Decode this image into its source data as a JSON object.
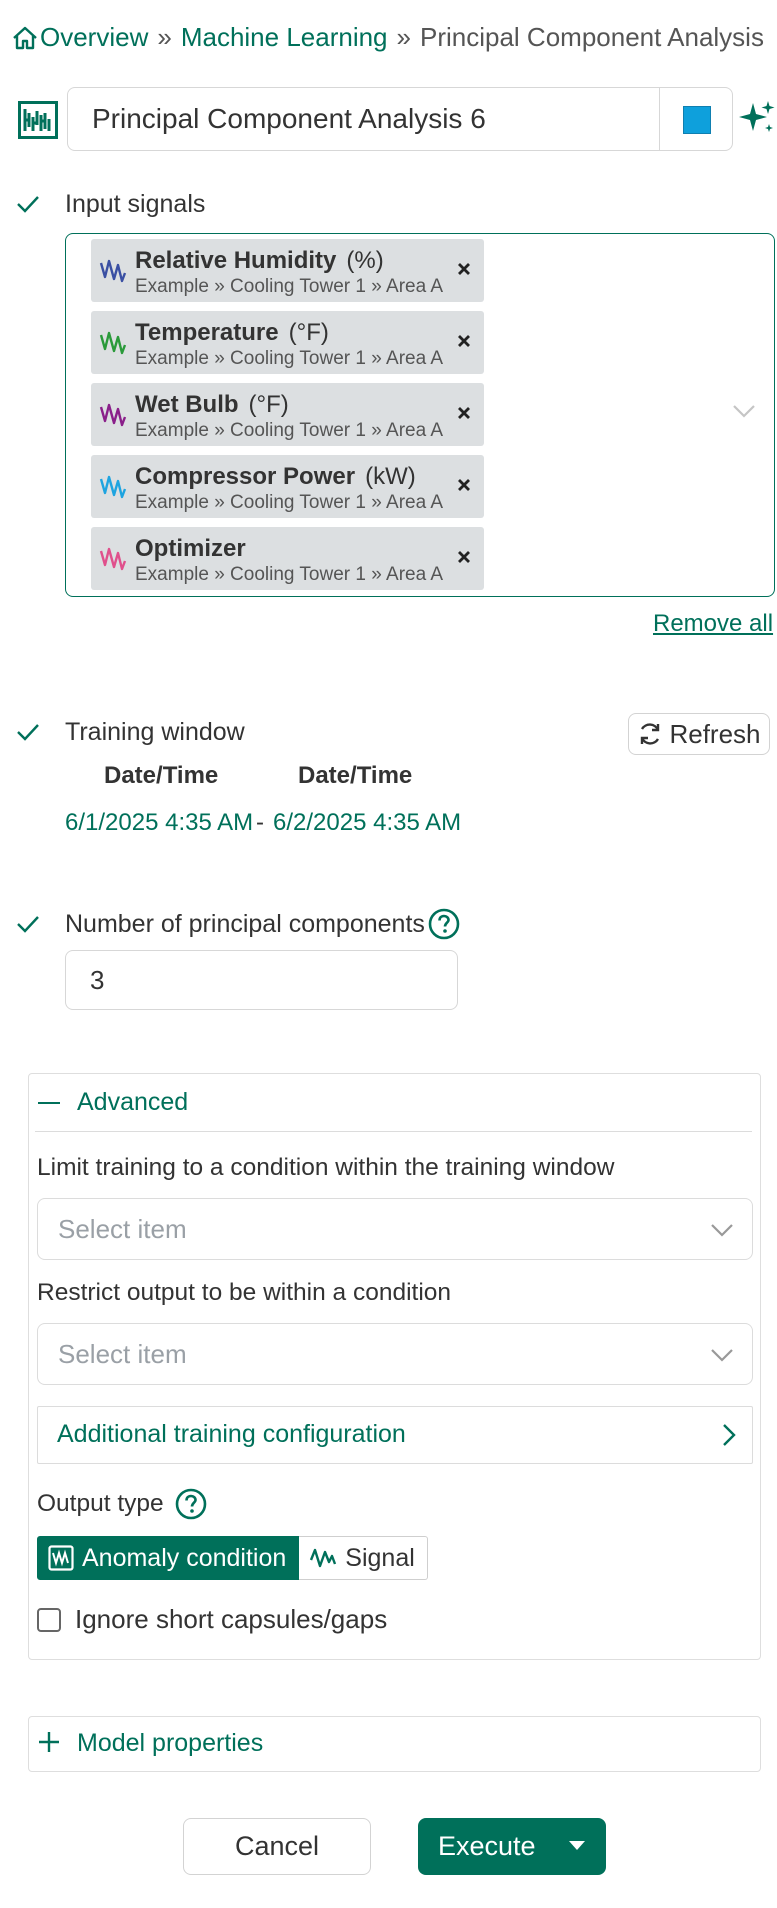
{
  "breadcrumb": {
    "home_label": "Overview",
    "separator": "»",
    "level2": "Machine Learning",
    "current": "Principal Component Analysis"
  },
  "tool": {
    "icon": "pca-tool-icon",
    "name_value": "Principal Component Analysis 6",
    "color": "#0ea0dc",
    "assistant_icon": "sparkle-icon"
  },
  "input_signals": {
    "label": "Input signals",
    "signals": [
      {
        "name": "Relative Humidity",
        "unit": "(%)",
        "path": "Example » Cooling Tower 1 » Area A",
        "color": "#3a4fa3"
      },
      {
        "name": "Temperature",
        "unit": "(°F)",
        "path": "Example » Cooling Tower 1 » Area A",
        "color": "#2a9a3a"
      },
      {
        "name": "Wet Bulb",
        "unit": "(°F)",
        "path": "Example » Cooling Tower 1 » Area A",
        "color": "#8a1f8a"
      },
      {
        "name": "Compressor Power",
        "unit": "(kW)",
        "path": "Example » Cooling Tower 1 » Area A",
        "color": "#1ea4e0"
      },
      {
        "name": "Optimizer",
        "unit": "",
        "path": "Example » Cooling Tower 1 » Area A",
        "color": "#e0508c"
      }
    ],
    "remove_all": "Remove all"
  },
  "training_window": {
    "label": "Training window",
    "refresh": "Refresh",
    "start_header": "Date/Time",
    "end_header": "Date/Time",
    "start": "6/1/2025 4:35 AM",
    "separator": "-",
    "end": "6/2/2025 4:35 AM"
  },
  "components": {
    "label": "Number of principal components",
    "value": "3"
  },
  "advanced": {
    "title": "Advanced",
    "limit_label": "Limit training to a condition within the training window",
    "limit_placeholder": "Select item",
    "restrict_label": "Restrict output to be within a condition",
    "restrict_placeholder": "Select item",
    "additional_config": "Additional training configuration",
    "output_type_label": "Output type",
    "output_options": [
      "Anomaly condition",
      "Signal"
    ],
    "selected_output": "Anomaly condition",
    "ignore_short": "Ignore short capsules/gaps",
    "ignore_short_checked": false
  },
  "model_properties": "Model properties",
  "actions": {
    "cancel": "Cancel",
    "execute": "Execute"
  },
  "colors": {
    "accent": "#00705a",
    "chip_bg": "#dcdfe1"
  }
}
